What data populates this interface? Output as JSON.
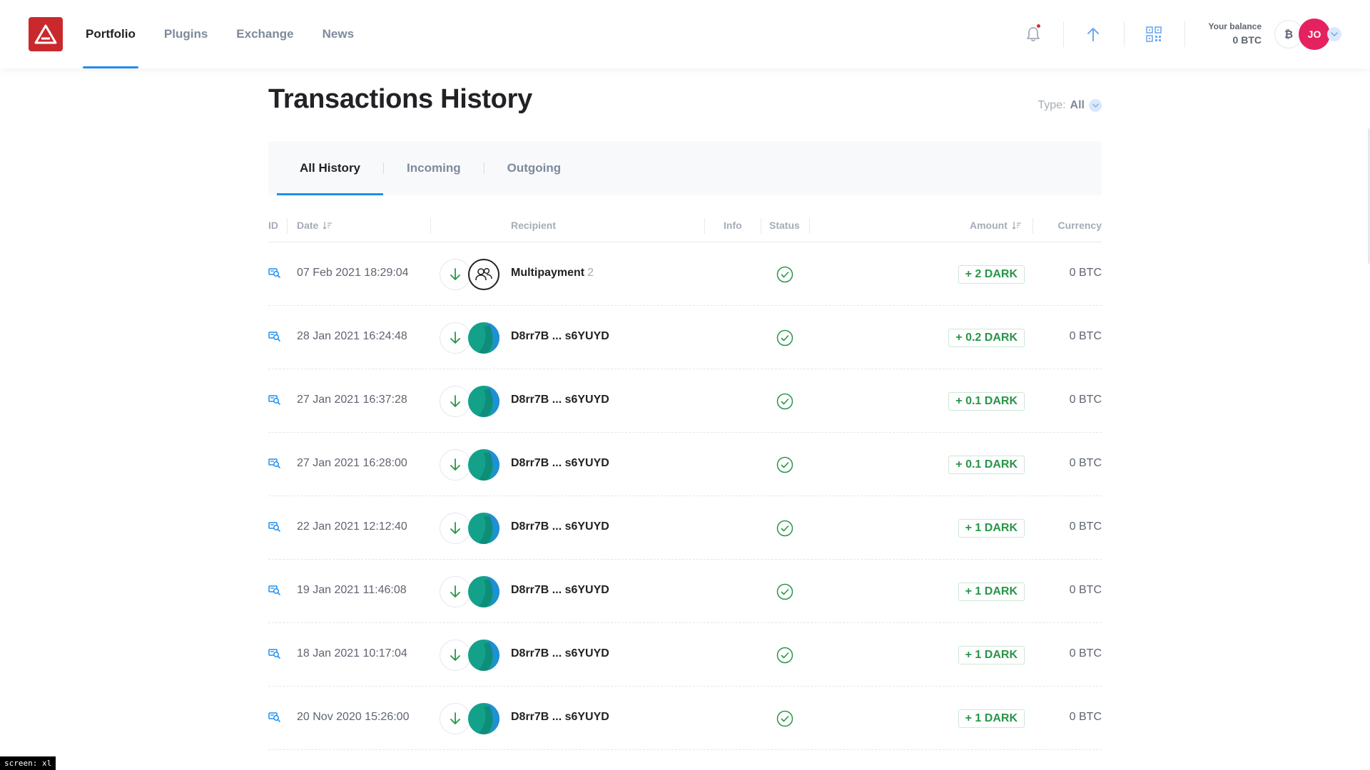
{
  "header": {
    "nav": [
      {
        "label": "Portfolio",
        "active": true
      },
      {
        "label": "Plugins",
        "active": false
      },
      {
        "label": "Exchange",
        "active": false
      },
      {
        "label": "News",
        "active": false
      }
    ],
    "balance_label": "Your balance",
    "balance_value": "0 BTC",
    "coin_symbol": "₿",
    "avatar_initials": "JO",
    "icons": [
      "notification-bell-icon",
      "send-arrow-icon",
      "qr-code-icon"
    ]
  },
  "page": {
    "title": "Transactions History",
    "type_filter_label": "Type:",
    "type_filter_value": "All"
  },
  "tabs": [
    {
      "label": "All History",
      "active": true
    },
    {
      "label": "Incoming",
      "active": false
    },
    {
      "label": "Outgoing",
      "active": false
    }
  ],
  "table": {
    "columns": {
      "id": "ID",
      "date": "Date",
      "recipient": "Recipient",
      "info": "Info",
      "status": "Status",
      "amount": "Amount",
      "currency": "Currency"
    },
    "rows": [
      {
        "date": "07 Feb 2021 18:29:04",
        "recipient": "Multipayment",
        "recipient_count": "2",
        "multi": true,
        "amount": "+ 2 DARK",
        "currency": "0 BTC"
      },
      {
        "date": "28 Jan 2021 16:24:48",
        "recipient": "D8rr7B ... s6YUYD",
        "recipient_count": "",
        "multi": false,
        "amount": "+ 0.2 DARK",
        "currency": "0 BTC"
      },
      {
        "date": "27 Jan 2021 16:37:28",
        "recipient": "D8rr7B ... s6YUYD",
        "recipient_count": "",
        "multi": false,
        "amount": "+ 0.1 DARK",
        "currency": "0 BTC"
      },
      {
        "date": "27 Jan 2021 16:28:00",
        "recipient": "D8rr7B ... s6YUYD",
        "recipient_count": "",
        "multi": false,
        "amount": "+ 0.1 DARK",
        "currency": "0 BTC"
      },
      {
        "date": "22 Jan 2021 12:12:40",
        "recipient": "D8rr7B ... s6YUYD",
        "recipient_count": "",
        "multi": false,
        "amount": "+ 1 DARK",
        "currency": "0 BTC"
      },
      {
        "date": "19 Jan 2021 11:46:08",
        "recipient": "D8rr7B ... s6YUYD",
        "recipient_count": "",
        "multi": false,
        "amount": "+ 1 DARK",
        "currency": "0 BTC"
      },
      {
        "date": "18 Jan 2021 10:17:04",
        "recipient": "D8rr7B ... s6YUYD",
        "recipient_count": "",
        "multi": false,
        "amount": "+ 1 DARK",
        "currency": "0 BTC"
      },
      {
        "date": "20 Nov 2020 15:26:00",
        "recipient": "D8rr7B ... s6YUYD",
        "recipient_count": "",
        "multi": false,
        "amount": "+ 1 DARK",
        "currency": "0 BTC"
      }
    ]
  },
  "colors": {
    "brand": "#c9292c",
    "accent": "#1d8ff0",
    "positive": "#289548",
    "avatar": "#e6215f"
  },
  "debug_badge": "screen: xl"
}
